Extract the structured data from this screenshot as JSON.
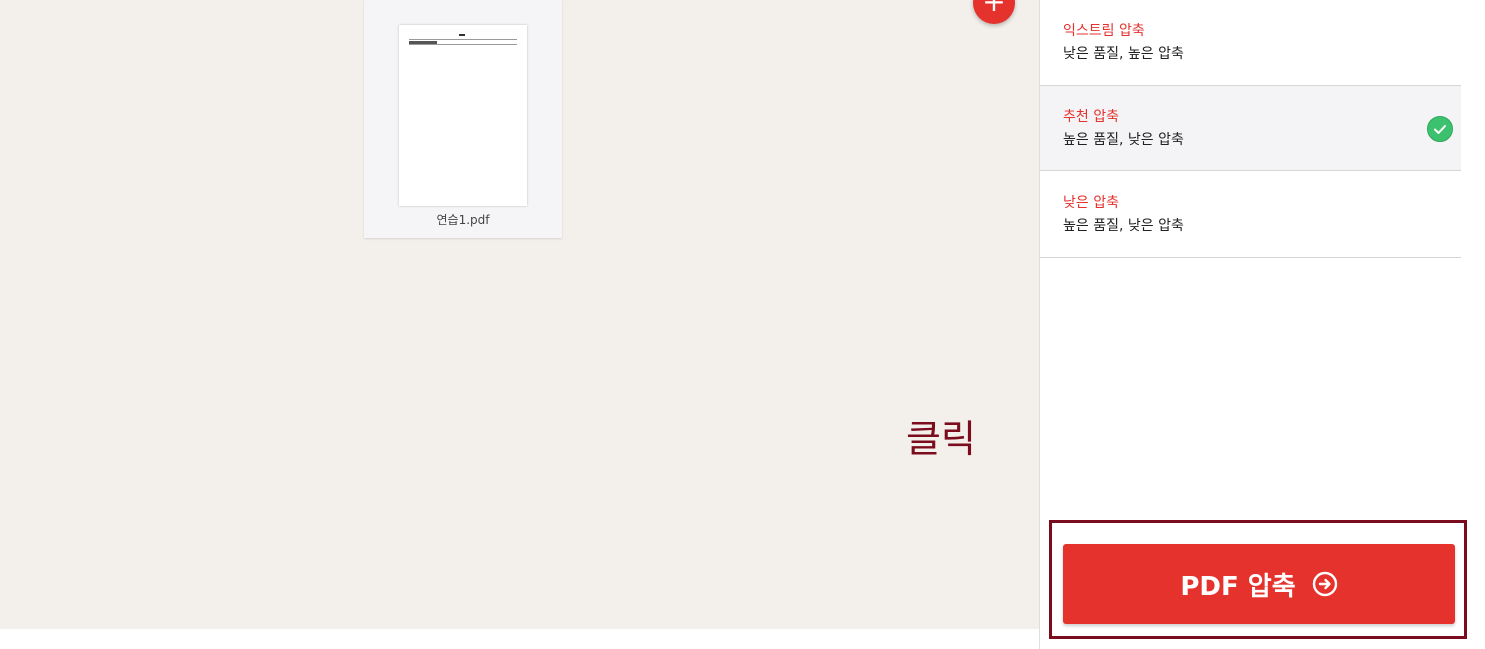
{
  "file": {
    "name": "연습1.pdf"
  },
  "annotation": {
    "text": "클릭"
  },
  "compression": {
    "options": [
      {
        "title": "익스트림 압축",
        "desc": "낮은 품질, 높은 압축",
        "selected": false
      },
      {
        "title": "추천 압축",
        "desc": "높은 품질, 낮은 압축",
        "selected": true
      },
      {
        "title": "낮은 압축",
        "desc": "높은 품질, 낮은 압축",
        "selected": false
      }
    ]
  },
  "action": {
    "label": "PDF 압축"
  },
  "icons": {
    "add": "plus-icon",
    "selected": "check-icon",
    "submit": "arrow-right-circle-icon"
  },
  "colors": {
    "brand": "#e5322d",
    "check": "#3cc26f",
    "annotation": "#7b0c1d"
  }
}
